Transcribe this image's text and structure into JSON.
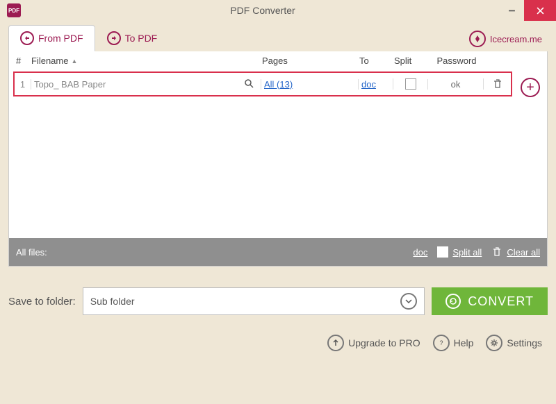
{
  "window": {
    "title": "PDF Converter"
  },
  "tabs": {
    "from_pdf": "From PDF",
    "to_pdf": "To PDF"
  },
  "brand_link": "Icecream.me",
  "columns": {
    "num": "#",
    "filename": "Filename",
    "pages": "Pages",
    "to": "To",
    "split": "Split",
    "password": "Password"
  },
  "rows": [
    {
      "num": "1",
      "filename": "Topo_ BAB Paper",
      "pages": "All (13)",
      "to": "doc",
      "password": "ok"
    }
  ],
  "footer": {
    "all_files": "All files:",
    "all_to": "doc",
    "split_all": "Split all",
    "clear_all": "Clear all"
  },
  "save": {
    "label": "Save to folder:",
    "value": "Sub folder"
  },
  "convert_label": "CONVERT",
  "bottom": {
    "upgrade": "Upgrade to PRO",
    "help": "Help",
    "settings": "Settings"
  }
}
